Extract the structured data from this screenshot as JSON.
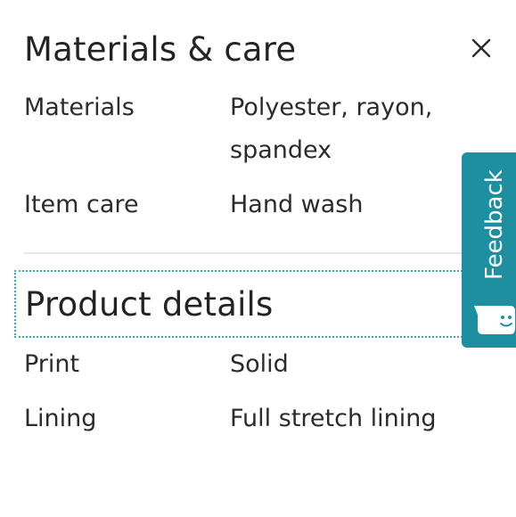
{
  "materials_care": {
    "title": "Materials & care",
    "close_icon": "close-icon",
    "rows": [
      {
        "label": "Materials",
        "value_line1": "Polyester, rayon,",
        "value_line2": "spandex"
      },
      {
        "label": "Item care",
        "value": "Hand wash"
      }
    ]
  },
  "product_details": {
    "title": "Product details",
    "rows": [
      {
        "label": "Print",
        "value": "Solid"
      },
      {
        "label": "Lining",
        "value": "Full stretch lining"
      }
    ]
  },
  "feedback": {
    "label": "Feedback",
    "icon": "chat-bubble-icon",
    "color": "#1e8fa0"
  },
  "colors": {
    "focus_outline": "#2ab3c4",
    "divider": "#e6e6e6",
    "text": "#2b2b2b"
  }
}
